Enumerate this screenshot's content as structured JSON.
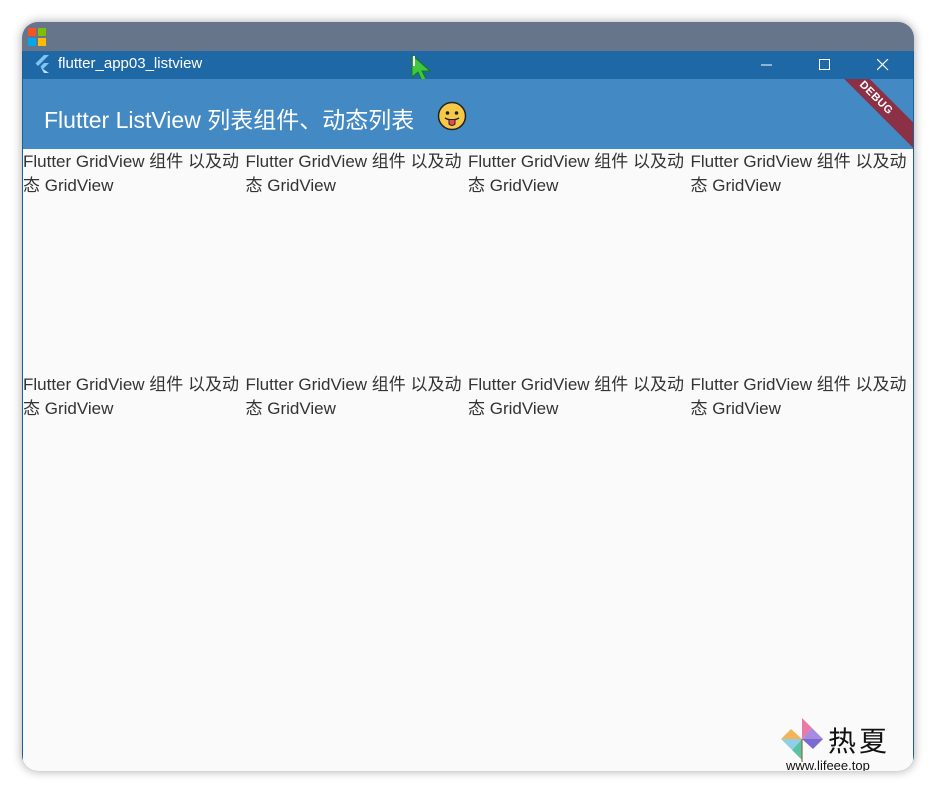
{
  "window": {
    "title": "flutter_app03_listview"
  },
  "appbar": {
    "title": "Flutter ListView 列表组件、动态列表",
    "debug_banner": "DEBUG",
    "color": "#4389c4"
  },
  "grid": {
    "items": [
      "Flutter GridView 组件 以及动态 GridView",
      "Flutter GridView 组件 以及动态 GridView",
      "Flutter GridView 组件 以及动态 GridView",
      "Flutter GridView 组件 以及动态 GridView",
      "Flutter GridView 组件 以及动态 GridView",
      "Flutter GridView 组件 以及动态 GridView",
      "Flutter GridView 组件 以及动态 GridView",
      "Flutter GridView 组件 以及动态 GridView"
    ]
  },
  "watermark": {
    "name": "热夏",
    "url": "www.lifeee.top"
  },
  "icons": {
    "app": "flutter-icon",
    "emoji": "tongue-out-emoji-icon",
    "minimize": "minimize-icon",
    "maximize": "maximize-icon",
    "close": "close-icon"
  }
}
